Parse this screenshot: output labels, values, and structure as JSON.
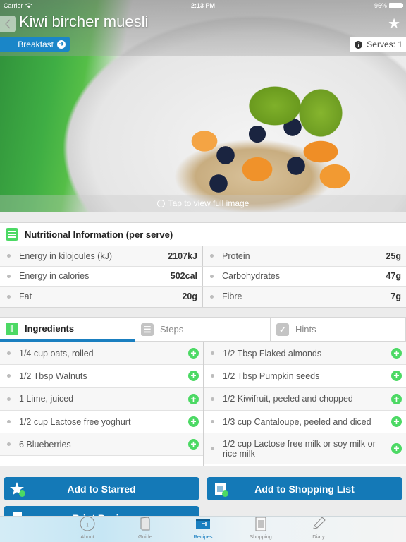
{
  "status_bar": {
    "carrier": "Carrier",
    "time": "2:13 PM",
    "battery": "96%"
  },
  "header": {
    "title": "Kiwi bircher muesli",
    "category": "Breakfast",
    "serves": "Serves: 1",
    "view_full_image": "Tap to view full image"
  },
  "nutrition": {
    "heading": "Nutritional Information (per serve)",
    "left": [
      {
        "label": "Energy in kilojoules (kJ)",
        "value": "2107kJ"
      },
      {
        "label": "Energy in calories",
        "value": "502cal"
      },
      {
        "label": "Fat",
        "value": "20g"
      }
    ],
    "right": [
      {
        "label": "Protein",
        "value": "25g"
      },
      {
        "label": "Carbohydrates",
        "value": "47g"
      },
      {
        "label": "Fibre",
        "value": "7g"
      }
    ]
  },
  "tabs": [
    {
      "label": "Ingredients",
      "icon": "cutlery-icon",
      "active": true
    },
    {
      "label": "Steps",
      "icon": "list-icon",
      "active": false
    },
    {
      "label": "Hints",
      "icon": "checkmark-icon",
      "active": false
    }
  ],
  "ingredients": {
    "left": [
      "1/4 cup oats, rolled",
      "1/2 Tbsp Walnuts",
      "1 Lime, juiced",
      "1/2 cup Lactose free yoghurt",
      "6 Blueberries"
    ],
    "right": [
      "1/2 Tbsp Flaked almonds",
      "1/2 Tbsp Pumpkin seeds",
      "1/2 Kiwifruit, peeled and chopped",
      "1/3 cup Cantaloupe, peeled and diced",
      "1/2 cup Lactose free milk or soy milk or rice milk"
    ]
  },
  "actions": {
    "starred": "Add to Starred",
    "shopping": "Add to Shopping List",
    "print": "Print Recipe"
  },
  "tabbar": [
    {
      "label": "About",
      "active": false
    },
    {
      "label": "Guide",
      "active": false
    },
    {
      "label": "Recipes",
      "active": true
    },
    {
      "label": "Shopping",
      "active": false
    },
    {
      "label": "Diary",
      "active": false
    }
  ],
  "colors": {
    "accent": "#1479b7",
    "green": "#4cd964",
    "tab_active": "#1a7fc0"
  }
}
